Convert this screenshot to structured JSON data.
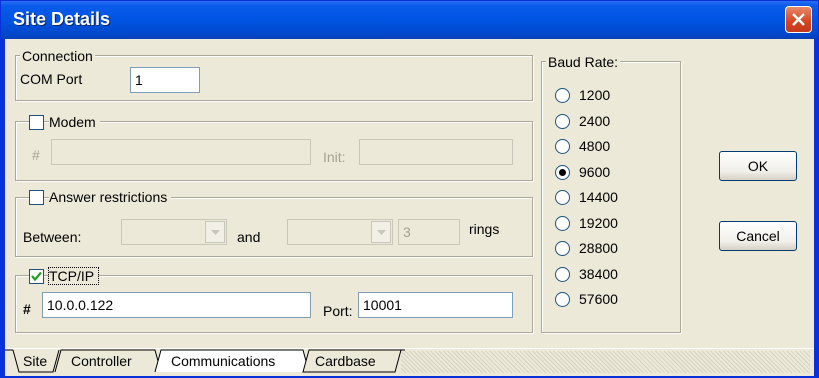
{
  "window": {
    "title": "Site Details"
  },
  "connection": {
    "legend": "Connection",
    "com_port_label": "COM Port",
    "com_port_value": "1"
  },
  "modem": {
    "label": "Modem",
    "checked": false,
    "hash_label": "#",
    "number_value": "",
    "init_label": "Init:",
    "init_value": ""
  },
  "answer": {
    "label": "Answer restrictions",
    "checked": false,
    "between_label": "Between:",
    "and_label": "and",
    "rings_value": "3",
    "rings_label": "rings"
  },
  "tcpip": {
    "label": "TCP/IP",
    "checked": true,
    "hash_label": "#",
    "ip_value": "10.0.0.122",
    "port_label": "Port:",
    "port_value": "10001"
  },
  "baud": {
    "legend": "Baud Rate:",
    "options": [
      "1200",
      "2400",
      "4800",
      "9600",
      "14400",
      "19200",
      "28800",
      "38400",
      "57600"
    ],
    "selected": "9600"
  },
  "buttons": {
    "ok": "OK",
    "cancel": "Cancel"
  },
  "tabs": [
    "Site",
    "Controller",
    "Communications",
    "Cardbase"
  ],
  "active_tab": "Communications"
}
